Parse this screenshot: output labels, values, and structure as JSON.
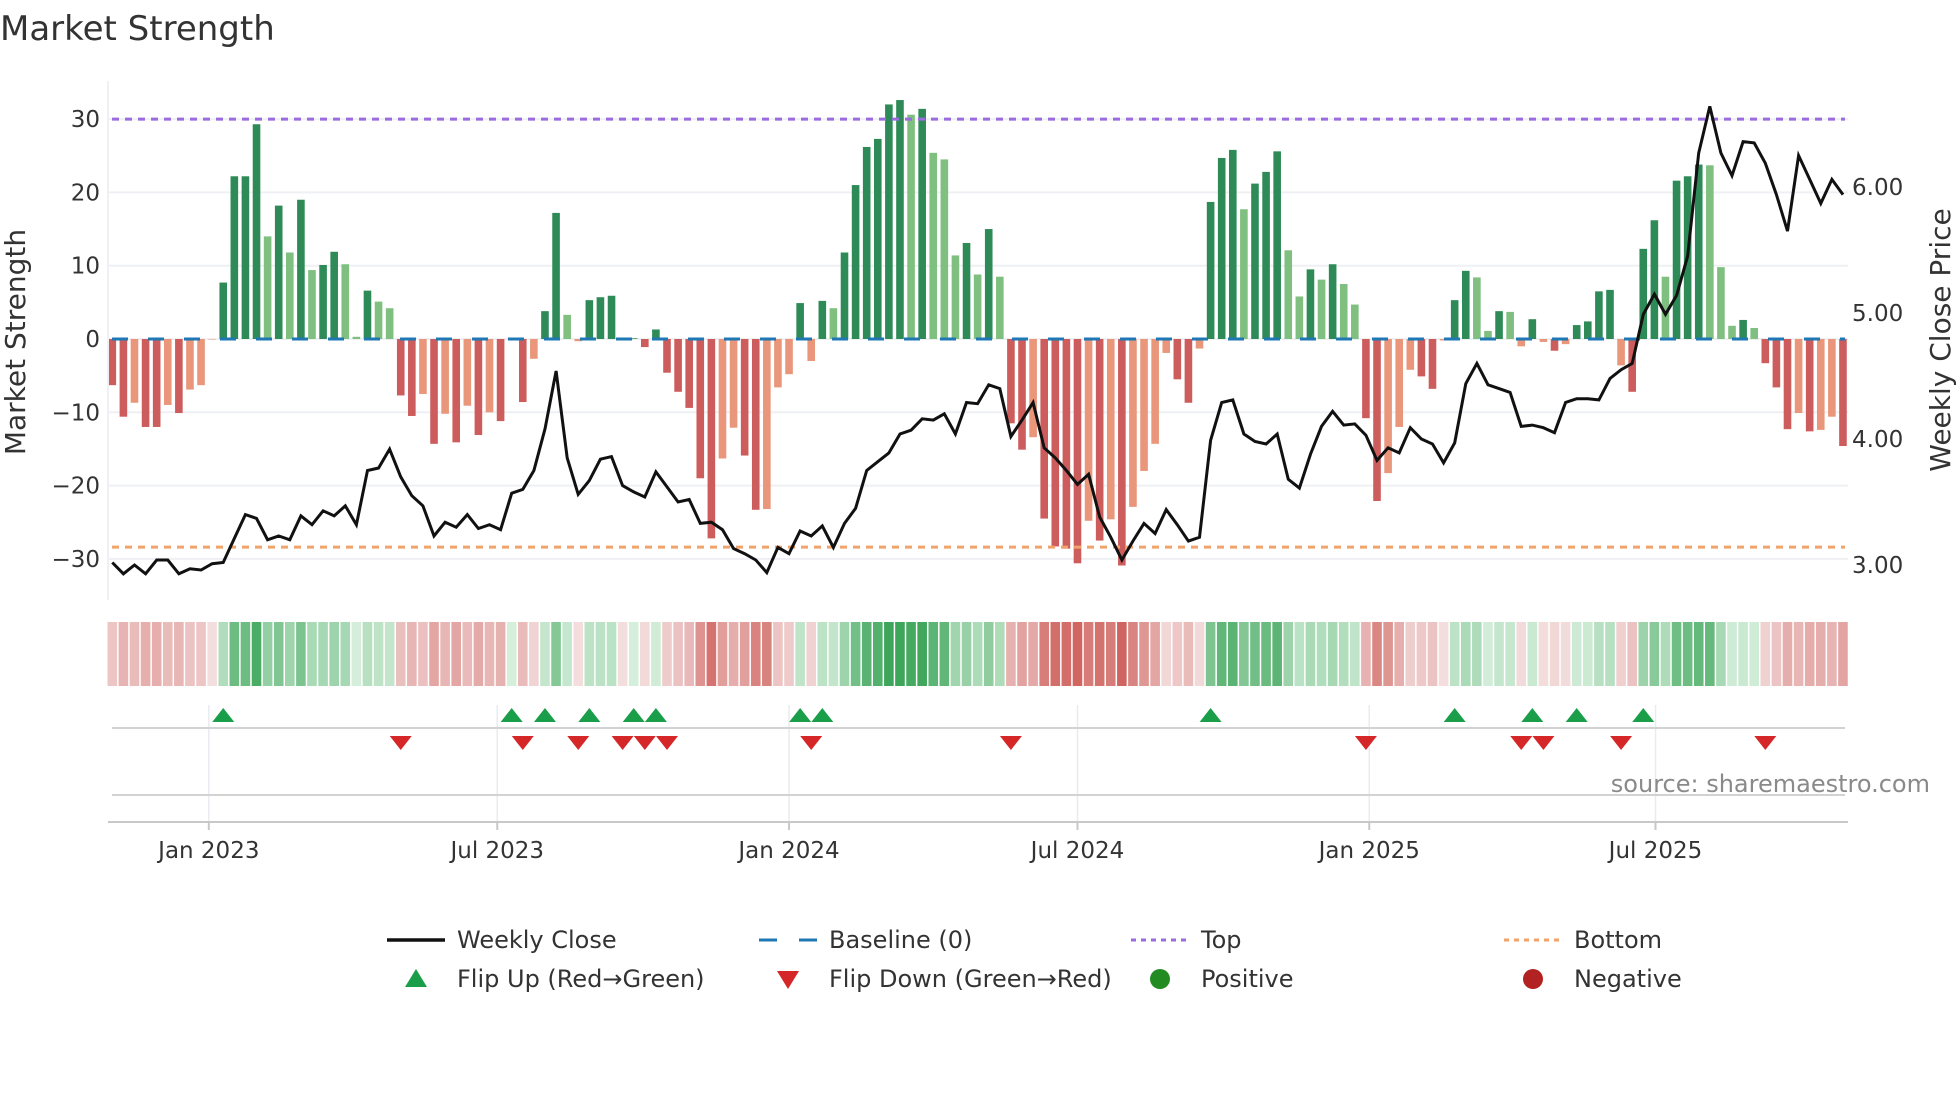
{
  "chart_data": {
    "type": "bar+line",
    "title": "Market Strength",
    "ylabel": "Market Strength",
    "y2label": "Weekly Close Price",
    "ylim": [
      -35.6,
      35.2
    ],
    "y2lim": [
      2.72,
      6.84
    ],
    "grid": true,
    "yticks": [
      {
        "value": 30,
        "label": "30"
      },
      {
        "value": 20,
        "label": "20"
      },
      {
        "value": 10,
        "label": "10"
      },
      {
        "value": 0,
        "label": "0"
      },
      {
        "value": -10,
        "label": "−10"
      },
      {
        "value": -20,
        "label": "−20"
      },
      {
        "value": -30,
        "label": "−30"
      }
    ],
    "y2ticks": [
      {
        "value": 6,
        "label": "6.00"
      },
      {
        "value": 5,
        "label": "5.00"
      },
      {
        "value": 4,
        "label": "4.00"
      },
      {
        "value": 3,
        "label": "3.00"
      }
    ],
    "xticks": [
      {
        "week": 8.7,
        "label": "Jan 2023"
      },
      {
        "week": 34.7,
        "label": "Jul 2023"
      },
      {
        "week": 61.0,
        "label": "Jan 2024"
      },
      {
        "week": 87.0,
        "label": "Jul 2024"
      },
      {
        "week": 113.3,
        "label": "Jan 2025"
      },
      {
        "week": 139.1,
        "label": "Jul 2025"
      }
    ],
    "top_level": 30,
    "bottom_level": -28.4,
    "baseline": 0,
    "strength": [
      -6.3,
      -10.6,
      -8.7,
      -12.0,
      -12.0,
      -9.0,
      -10.1,
      -6.9,
      -6.3,
      0,
      7.7,
      22.2,
      22.2,
      29.3,
      14.0,
      18.2,
      11.8,
      19.0,
      9.4,
      10.1,
      11.9,
      10.2,
      0.3,
      6.6,
      5.1,
      4.2,
      -7.7,
      -10.5,
      -7.5,
      -14.3,
      -10.2,
      -14.1,
      -9.1,
      -13.1,
      -10.0,
      -11.2,
      0.2,
      -8.6,
      -2.7,
      3.8,
      17.2,
      3.3,
      -0.3,
      5.3,
      5.7,
      5.9,
      -0.1,
      0.1,
      -1.1,
      1.3,
      -4.6,
      -7.2,
      -9.4,
      -19.0,
      -27.2,
      -16.3,
      -12.1,
      -15.9,
      -23.3,
      -23.2,
      -6.6,
      -4.8,
      4.9,
      -3.0,
      5.2,
      4.2,
      11.8,
      21.0,
      26.2,
      27.3,
      32.0,
      32.6,
      30.6,
      31.4,
      25.4,
      24.5,
      11.4,
      13.1,
      8.8,
      15.0,
      8.5,
      -11.5,
      -15.1,
      -13.4,
      -24.5,
      -28.3,
      -28.6,
      -30.6,
      -24.8,
      -27.5,
      -24.6,
      -30.9,
      -22.9,
      -18.0,
      -14.3,
      -1.9,
      -5.5,
      -8.7,
      -1.3,
      18.7,
      24.7,
      25.8,
      17.7,
      21.2,
      22.8,
      25.6,
      12.1,
      5.8,
      9.5,
      8.1,
      10.2,
      7.5,
      4.7,
      -10.8,
      -22.1,
      -18.3,
      -12.0,
      -4.2,
      -5.1,
      -6.8,
      -0.2,
      5.3,
      9.3,
      8.4,
      1.1,
      3.8,
      3.7,
      -1.0,
      2.7,
      -0.4,
      -1.6,
      -0.7,
      1.9,
      2.4,
      6.5,
      6.7,
      -3.6,
      -7.2,
      12.3,
      16.2,
      8.5,
      21.6,
      22.2,
      23.8,
      23.7,
      9.8,
      1.8,
      2.6,
      1.5,
      -3.3,
      -6.6,
      -12.3,
      -10.1,
      -12.6,
      -12.4,
      -10.6,
      -14.6
    ],
    "weekly_close": [
      3.02,
      2.93,
      3.0,
      2.93,
      3.04,
      3.04,
      2.93,
      2.97,
      2.96,
      3.01,
      3.02,
      3.21,
      3.4,
      3.37,
      3.2,
      3.23,
      3.2,
      3.39,
      3.32,
      3.43,
      3.39,
      3.47,
      3.32,
      3.75,
      3.77,
      3.92,
      3.7,
      3.55,
      3.47,
      3.23,
      3.34,
      3.3,
      3.4,
      3.29,
      3.32,
      3.28,
      3.57,
      3.6,
      3.75,
      4.08,
      4.54,
      3.85,
      3.56,
      3.67,
      3.84,
      3.86,
      3.63,
      3.58,
      3.54,
      3.74,
      3.62,
      3.5,
      3.52,
      3.33,
      3.34,
      3.28,
      3.13,
      3.09,
      3.04,
      2.94,
      3.14,
      3.09,
      3.27,
      3.23,
      3.31,
      3.14,
      3.33,
      3.45,
      3.75,
      3.82,
      3.89,
      4.04,
      4.07,
      4.16,
      4.15,
      4.2,
      4.04,
      4.29,
      4.28,
      4.43,
      4.4,
      4.02,
      4.15,
      4.29,
      3.93,
      3.85,
      3.75,
      3.64,
      3.72,
      3.38,
      3.22,
      3.04,
      3.19,
      3.33,
      3.25,
      3.44,
      3.32,
      3.19,
      3.22,
      3.99,
      4.29,
      4.31,
      4.04,
      3.98,
      3.96,
      4.04,
      3.68,
      3.61,
      3.88,
      4.1,
      4.22,
      4.11,
      4.12,
      4.03,
      3.83,
      3.93,
      3.89,
      4.09,
      4.0,
      3.96,
      3.81,
      3.97,
      4.44,
      4.6,
      4.43,
      4.4,
      4.37,
      4.1,
      4.11,
      4.09,
      4.05,
      4.29,
      4.32,
      4.32,
      4.31,
      4.48,
      4.55,
      4.6,
      4.99,
      5.15,
      4.99,
      5.14,
      5.45,
      6.27,
      6.64,
      6.27,
      6.09,
      6.36,
      6.35,
      6.19,
      5.94,
      5.65,
      6.25,
      6.06,
      5.87,
      6.06,
      5.94
    ],
    "legend": {
      "placement": "bottom",
      "items": [
        {
          "label": "Weekly Close",
          "symbol": "line",
          "color": "#111111"
        },
        {
          "label": "Baseline (0)",
          "symbol": "dash",
          "color": "#1f77b4"
        },
        {
          "label": "Top",
          "symbol": "dot",
          "color": "#9b6bdf"
        },
        {
          "label": "Bottom",
          "symbol": "dot",
          "color": "#f0a36a"
        },
        {
          "label": "Flip Up (Red→Green)",
          "symbol": "triangle-up",
          "color": "#1a9e4a"
        },
        {
          "label": "Flip Down (Green→Red)",
          "symbol": "triangle-down",
          "color": "#d62728"
        },
        {
          "label": "Positive",
          "symbol": "circle",
          "color": "#228b22"
        },
        {
          "label": "Negative",
          "symbol": "circle",
          "color": "#b22222"
        }
      ]
    },
    "colors": {
      "pos_strong": "#2e8b57",
      "pos_weak": "#7fbf7f",
      "neg_strong": "#cd5c5c",
      "neg_weak": "#e9967a",
      "top": "#9b6bdf",
      "bottom": "#f0a36a",
      "baseline": "#1f77b4",
      "line": "#111111",
      "flip_up": "#1a9e4a",
      "flip_down": "#d62728"
    },
    "source": "source: sharemaestro.com"
  }
}
